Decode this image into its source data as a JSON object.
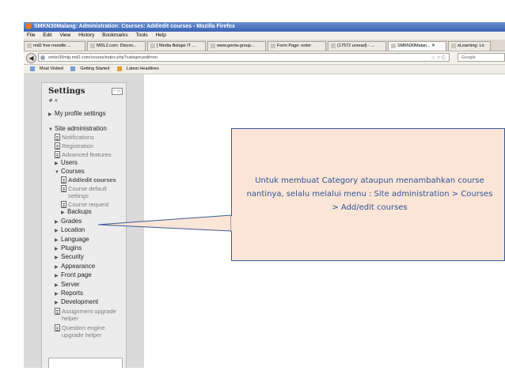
{
  "window": {
    "title": "SMKN30Malang: Administration: Courses: Add/edit courses - Mozilla Firefox"
  },
  "menu": [
    "File",
    "Edit",
    "View",
    "History",
    "Bookmarks",
    "Tools",
    "Help"
  ],
  "tabs": [
    {
      "label": "md2 free moodle ..."
    },
    {
      "label": "MDL2.com: Discov..."
    },
    {
      "label": "[ Media Belajar IT ..."
    },
    {
      "label": "www.genta-group..."
    },
    {
      "label": "Form Page: order"
    },
    {
      "label": "(17572 unread) - ..."
    },
    {
      "label": "SMKN30Malan... ✕",
      "active": true
    },
    {
      "label": "eLearning: Lo"
    }
  ],
  "nav": {
    "back_symbol": "◀",
    "url": "smkn30mlg.md2.com/course/index.php?categoryedit=on",
    "star_symbol": "☆ ▿ C",
    "search_placeholder": "Google"
  },
  "bookmarks": [
    "Most Visited",
    "Getting Started",
    "Latest Headlines"
  ],
  "settings": {
    "title": "Settings",
    "subtitle": "✥ ✕",
    "control_symbol": "– ▭",
    "my_profile": "My profile settings",
    "site_admin": "Site administration",
    "admin_items": [
      "Notifications",
      "Registration",
      "Advanced features"
    ],
    "users": "Users",
    "courses": "Courses",
    "course_items": [
      {
        "label": "Add/edit courses",
        "active": true
      },
      {
        "label": "Course default settings",
        "active": false
      },
      {
        "label": "Course request",
        "active": false
      }
    ],
    "course_default_line1": "Course default",
    "course_default_line2": "settings",
    "backups": "Backups",
    "sections": [
      "Grades",
      "Location",
      "Language",
      "Plugins",
      "Security",
      "Appearance",
      "Front page",
      "Server",
      "Reports",
      "Development"
    ],
    "assignment_helper_line1": "Assignment upgrade",
    "assignment_helper_line2": "helper",
    "question_helper_line1": "Question engine",
    "question_helper_line2": "upgrade helper"
  },
  "callout": {
    "text": "Untuk membuat Category ataupun menambahkan course nantinya, selalu melalui menu : Site administration > Courses > Add/edit courses",
    "fill": "#fbe5d6",
    "border": "#3b5998",
    "text_color": "#2f5496"
  },
  "colors": {
    "titlebar": "#3b63b5",
    "sidebar_bg": "#dadada",
    "link_gray": "#7d7d7d"
  }
}
